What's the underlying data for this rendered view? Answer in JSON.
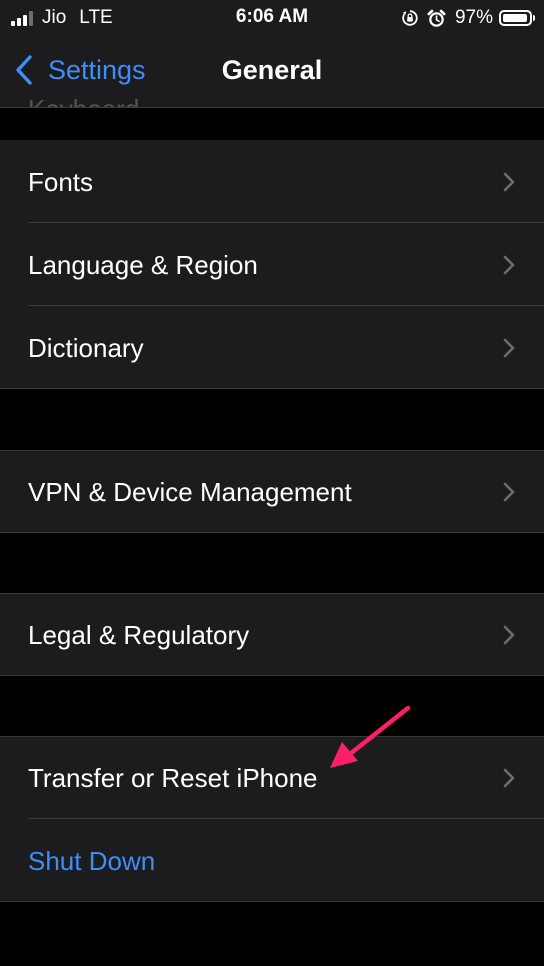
{
  "status_bar": {
    "carrier": "Jio",
    "network": "LTE",
    "time": "6:06 AM",
    "battery": "97%",
    "battery_level": 0.97
  },
  "nav": {
    "back_label": "Settings",
    "title": "General",
    "partial_previous_item": "Keyboard"
  },
  "groups": [
    {
      "items": [
        "Fonts",
        "Language & Region",
        "Dictionary"
      ]
    },
    {
      "items": [
        "VPN & Device Management"
      ]
    },
    {
      "items": [
        "Legal & Regulatory"
      ]
    },
    {
      "items": [
        "Transfer or Reset iPhone",
        "Shut Down"
      ]
    }
  ],
  "colors": {
    "background": "#000000",
    "cell": "#1c1c1e",
    "accent_blue": "#3d8ef7",
    "separator": "#38383a",
    "chevron": "#6b6b70",
    "annotation_arrow": "#ff1f66"
  },
  "icons": {
    "back": "chevron-left-icon",
    "disclosure": "chevron-right-icon",
    "orientation_lock": "orientation-lock-icon",
    "alarm": "alarm-icon"
  }
}
